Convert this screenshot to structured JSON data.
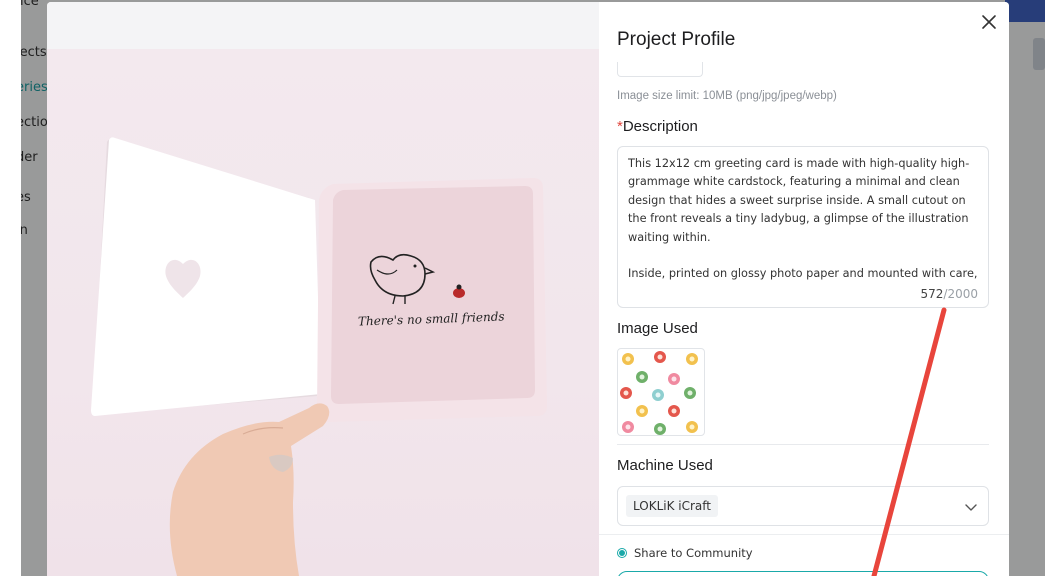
{
  "background": {
    "top_left_text": "ice",
    "sidebar_items": [
      {
        "label": "jects",
        "active": false
      },
      {
        "label": "eries",
        "active": true
      },
      {
        "label": "ectio",
        "active": false
      },
      {
        "label": "der",
        "active": false
      },
      {
        "label": "es",
        "active": false
      },
      {
        "label": "in",
        "active": false
      }
    ]
  },
  "modal": {
    "title": "Project Profile",
    "image_size_limit": "Image size limit: 10MB (png/jpg/jpeg/webp)",
    "description": {
      "required_mark": "*",
      "label": "Description",
      "text": "This 12x12 cm greeting card is made with high-quality high-grammage white cardstock, featuring a minimal and clean design that hides a sweet surprise inside. A small cutout on the front reveals a tiny ladybug, a glimpse of the illustration waiting within.\n\nInside, printed on glossy photo paper and mounted with care,",
      "count": "572",
      "separator": "/",
      "max": "2000"
    },
    "image_used_label": "Image Used",
    "machine_used_label": "Machine Used",
    "machine_selected": "LOKLiK iCraft",
    "share_label": "Share to Community",
    "photo": {
      "card_caption": "There's no small friends"
    }
  },
  "colors": {
    "accent": "#1aa9a9",
    "required": "#e0453c",
    "annotation_arrow": "#e8453c"
  }
}
